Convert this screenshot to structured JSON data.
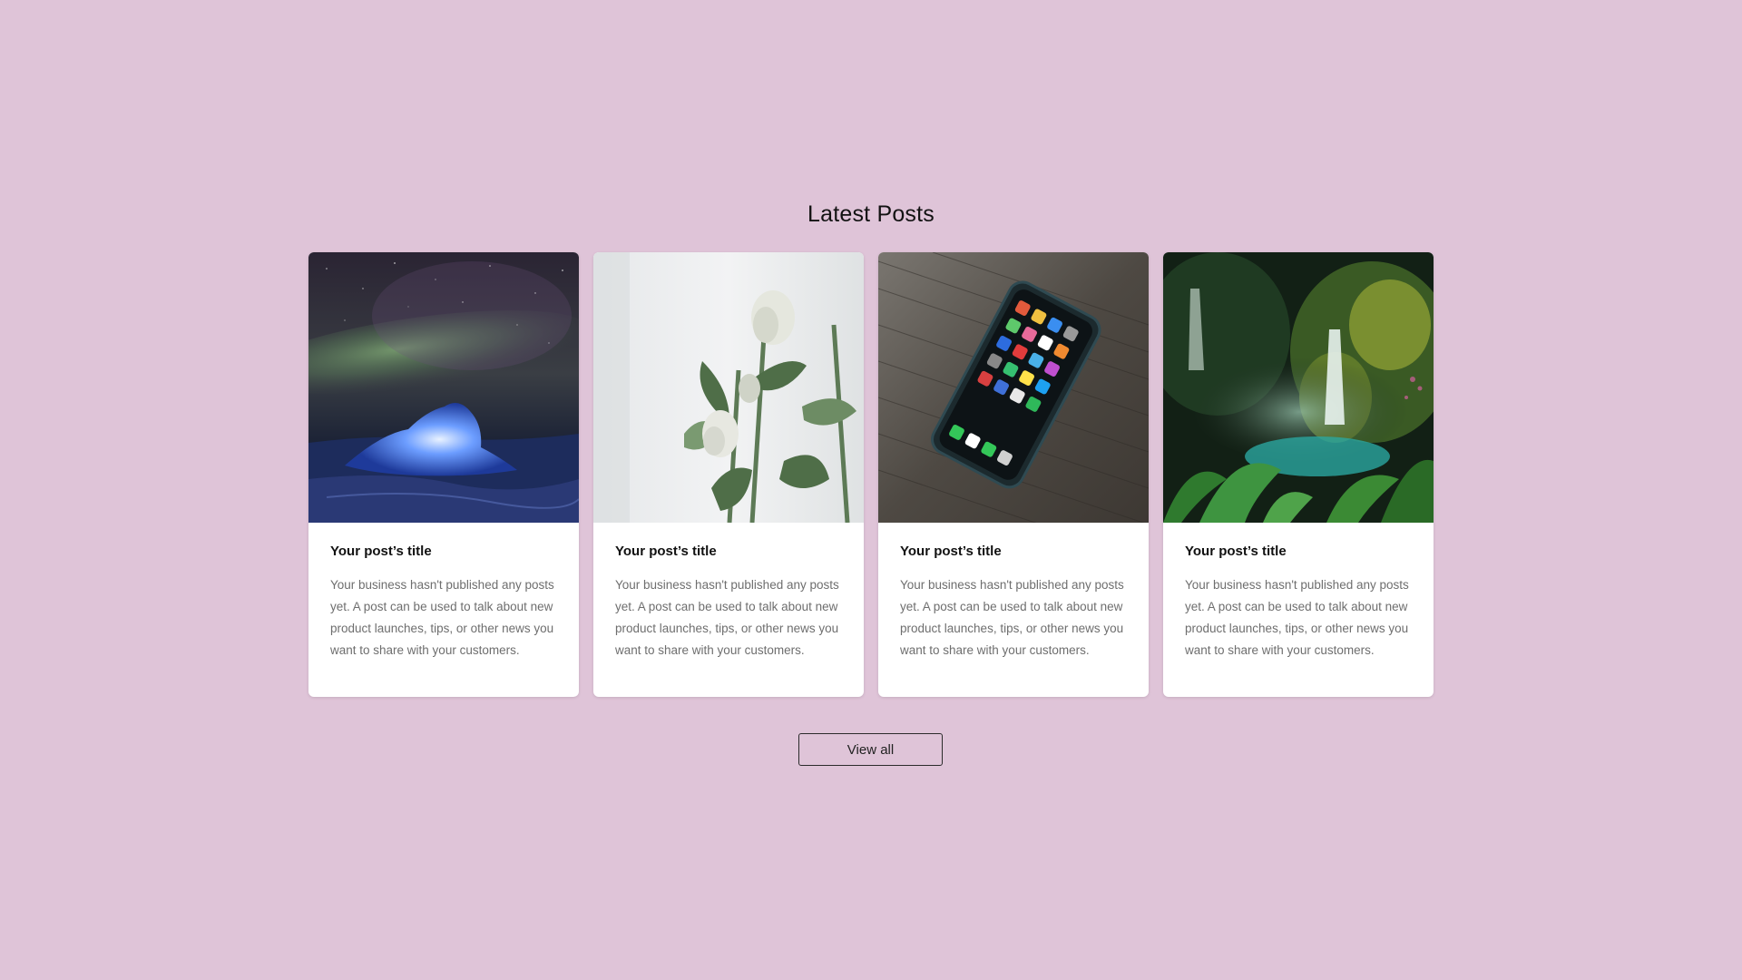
{
  "section": {
    "title": "Latest Posts",
    "view_all_label": "View all"
  },
  "posts": [
    {
      "title": "Your post’s title",
      "excerpt": "Your business hasn't published any posts yet. A post can be used to talk about new product launches, tips, or other news you want to share with your customers.",
      "image": "aurora-iceberg-photo"
    },
    {
      "title": "Your post’s title",
      "excerpt": "Your business hasn't published any posts yet. A post can be used to talk about new product launches, tips, or other news you want to share with your customers.",
      "image": "white-roses-photo"
    },
    {
      "title": "Your post’s title",
      "excerpt": "Your business hasn't published any posts yet. A post can be used to talk about new product launches, tips, or other news you want to share with your customers.",
      "image": "smartphone-on-table-photo"
    },
    {
      "title": "Your post’s title",
      "excerpt": "Your business hasn't published any posts yet. A post can be used to talk about new product launches, tips, or other news you want to share with your customers.",
      "image": "jungle-waterfall-photo"
    }
  ],
  "colors": {
    "background": "#dfc4d8",
    "card": "#ffffff",
    "title_text": "#111111",
    "excerpt_text": "#6e6e6e"
  }
}
